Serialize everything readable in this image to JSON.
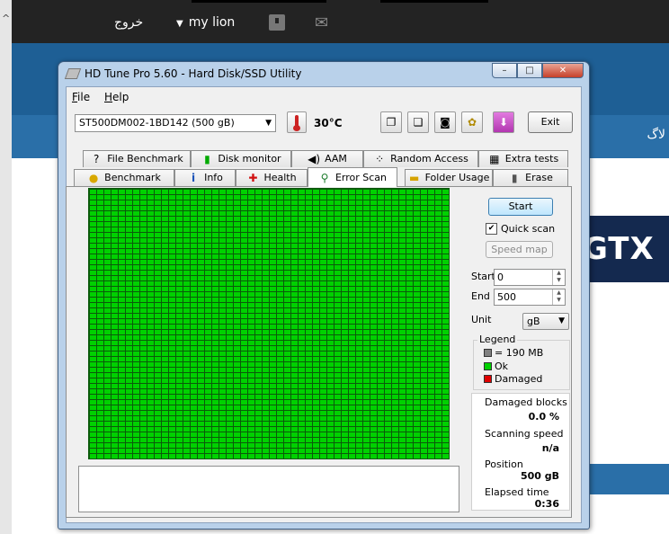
{
  "background": {
    "logout_text": "خروج",
    "user_name": "my lion",
    "right_text": "لاگ",
    "banner_text": "GTX"
  },
  "window": {
    "title": "HD Tune Pro 5.60 - Hard Disk/SSD Utility",
    "menu": [
      {
        "label": "File"
      },
      {
        "label": "Help"
      }
    ],
    "controls": {
      "minimize": "–",
      "maximize": "□",
      "close": "✕"
    }
  },
  "toolbar": {
    "drive": "ST500DM002-1BD142 (500 gB)",
    "temperature": "30°C",
    "exit_label": "Exit"
  },
  "tabs_top": [
    {
      "label": "File Benchmark",
      "icon": "file-benchmark-icon",
      "glyph": "?"
    },
    {
      "label": "Disk monitor",
      "icon": "disk-monitor-icon",
      "glyph": "▮"
    },
    {
      "label": "AAM",
      "icon": "speaker-icon",
      "glyph": "◀)"
    },
    {
      "label": "Random Access",
      "icon": "random-access-icon",
      "glyph": "⁘"
    },
    {
      "label": "Extra tests",
      "icon": "extra-tests-icon",
      "glyph": "▦"
    }
  ],
  "tabs_bottom": [
    {
      "label": "Benchmark",
      "icon": "bulb-icon",
      "glyph": "●"
    },
    {
      "label": "Info",
      "icon": "info-icon",
      "glyph": "i"
    },
    {
      "label": "Health",
      "icon": "health-cross-icon",
      "glyph": "✚"
    },
    {
      "label": "Error Scan",
      "icon": "magnifier-icon",
      "glyph": "⚲",
      "active": true
    },
    {
      "label": "Folder Usage",
      "icon": "folder-icon",
      "glyph": "▬"
    },
    {
      "label": "Erase",
      "icon": "trash-icon",
      "glyph": "▮"
    }
  ],
  "error_scan": {
    "start_label": "Start",
    "quick_scan_label": "Quick scan",
    "quick_scan_checked": true,
    "speed_map_label": "Speed map",
    "start_field_label": "Start",
    "start_value": "0",
    "end_field_label": "End",
    "end_value": "500",
    "unit_label": "Unit",
    "unit_value": "gB",
    "legend": {
      "title": "Legend",
      "items": [
        {
          "label": "= 190 MB",
          "color": "#808080"
        },
        {
          "label": "Ok",
          "color": "#00d100"
        },
        {
          "label": "Damaged",
          "color": "#e00000"
        }
      ]
    },
    "stats": {
      "damaged_blocks_label": "Damaged blocks",
      "damaged_blocks_value": "0.0 %",
      "scan_speed_label": "Scanning speed",
      "scan_speed_value": "n/a",
      "position_label": "Position",
      "position_value": "500 gB",
      "elapsed_label": "Elapsed time",
      "elapsed_value": "0:36"
    }
  }
}
